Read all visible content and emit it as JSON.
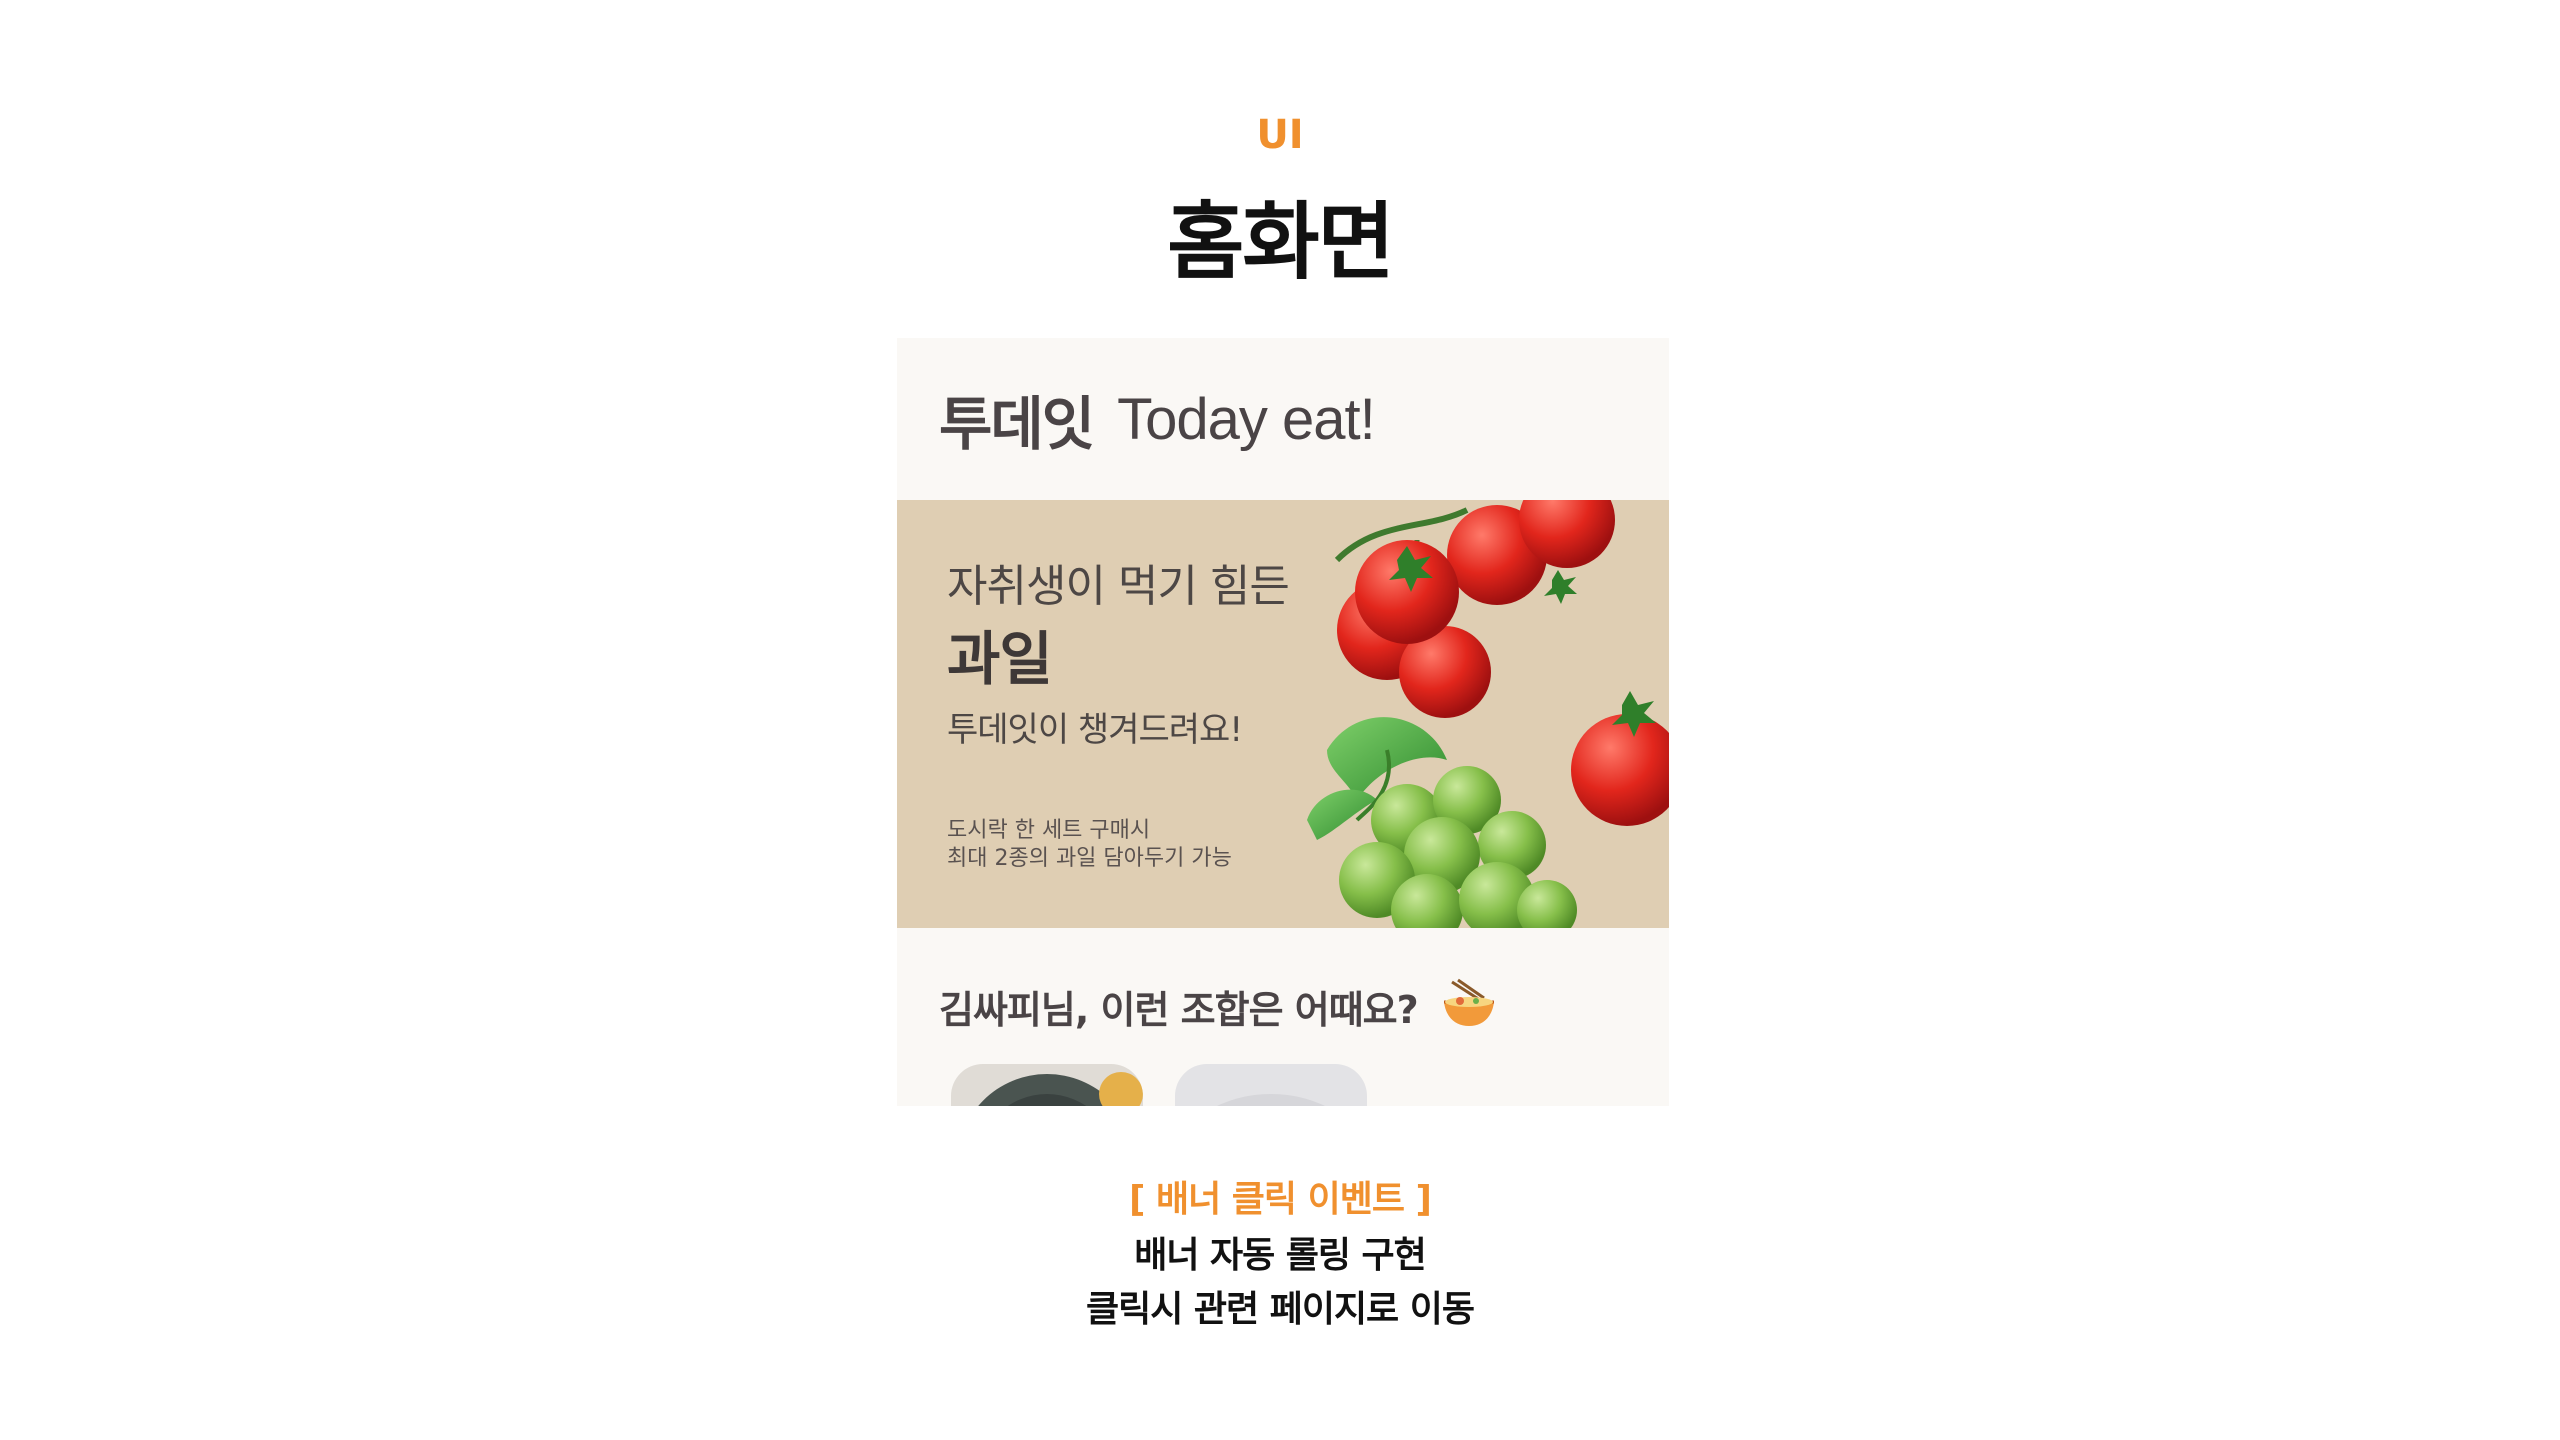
{
  "section": {
    "eyebrow": "UI",
    "title": "홈화면"
  },
  "app": {
    "brand_ko": "투데잇",
    "brand_en": "Today eat!",
    "background": "#faf8f5"
  },
  "banner": {
    "line1": "자취생이 먹기 힘든",
    "line2": "과일",
    "line3": "투데잇이 챙겨드려요!",
    "small1": "도시락 한 세트 구매시",
    "small2": "최대 2종의 과일 담아두기 가능",
    "background": "#dfceb3",
    "images": [
      "tomato-icon",
      "grape-icon"
    ]
  },
  "recommend": {
    "title": "김싸피님, 이런 조합은 어때요?",
    "icon": "noodle-bowl-icon",
    "cards": [
      "food-card-1",
      "food-card-2"
    ]
  },
  "caption": {
    "tag": "[ 배너 클릭 이벤트 ]",
    "line1": "배너 자동 롤링 구현",
    "line2": "클릭시 관련 페이지로 이동"
  },
  "colors": {
    "accent": "#f0902e",
    "text_dark": "#111111",
    "app_text": "#4a4446"
  }
}
